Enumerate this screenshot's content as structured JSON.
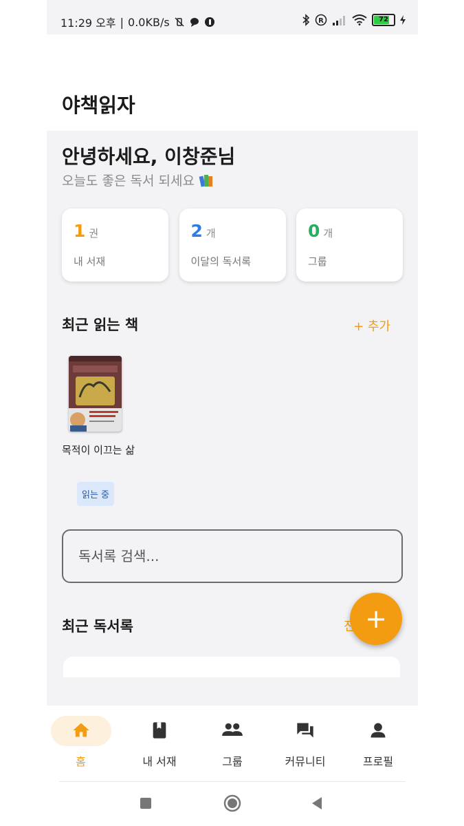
{
  "status_bar": {
    "time": "11:29 오후",
    "speed": "0.0KB/s",
    "battery": "72"
  },
  "app": {
    "title": "야책읽자"
  },
  "greeting": {
    "title": "안녕하세요, 이창준님",
    "subtitle": "오늘도 좋은 독서 되세요"
  },
  "stats": [
    {
      "value": "1",
      "unit": "권",
      "label": "내 서재",
      "color": "#f39c12"
    },
    {
      "value": "2",
      "unit": "개",
      "label": "이달의 독서록",
      "color": "#2f7be5"
    },
    {
      "value": "0",
      "unit": "개",
      "label": "그룹",
      "color": "#27ae60"
    }
  ],
  "recent_books": {
    "title": "최근 읽는 책",
    "add_label": "+ 추가",
    "items": [
      {
        "title": "목적이 이끄는 삶",
        "status": "읽는 중"
      }
    ]
  },
  "search": {
    "placeholder": "독서록 검색..."
  },
  "recent_reviews": {
    "title": "최근 독서록",
    "all_label": "전체"
  },
  "fab": {
    "label": "+"
  },
  "bottom_nav": [
    {
      "label": "홈",
      "icon": "home-icon",
      "active": true
    },
    {
      "label": "내 서재",
      "icon": "book-icon",
      "active": false
    },
    {
      "label": "그룹",
      "icon": "group-icon",
      "active": false
    },
    {
      "label": "커뮤니티",
      "icon": "forum-icon",
      "active": false
    },
    {
      "label": "프로필",
      "icon": "person-icon",
      "active": false
    }
  ],
  "colors": {
    "accent": "#f39c12",
    "background": "#f3f3f6"
  }
}
